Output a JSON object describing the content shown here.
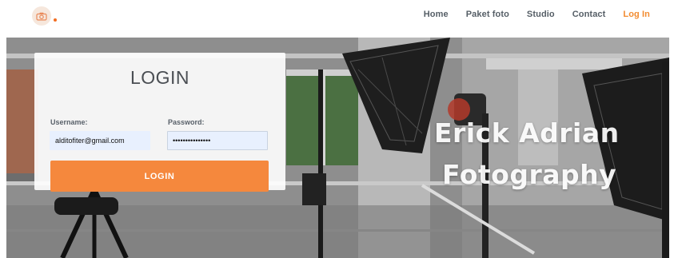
{
  "nav": {
    "logo_icon": "camera-logo-icon",
    "links": [
      {
        "label": "Home"
      },
      {
        "label": "Paket foto"
      },
      {
        "label": "Studio"
      },
      {
        "label": "Contact"
      },
      {
        "label": "Log In",
        "active": true
      }
    ]
  },
  "hero": {
    "title_line1": "Erick Adrian",
    "title_line2": "Fotography"
  },
  "login": {
    "heading": "LOGIN",
    "username_label": "Username:",
    "username_value": "alditofiter@gmail.com",
    "password_label": "Password:",
    "password_value": "•••••••••••••••",
    "button_label": "LOGIN"
  },
  "colors": {
    "accent": "#f5883d",
    "nav_active": "#f28b30",
    "input_bg": "#e8f0fe"
  }
}
